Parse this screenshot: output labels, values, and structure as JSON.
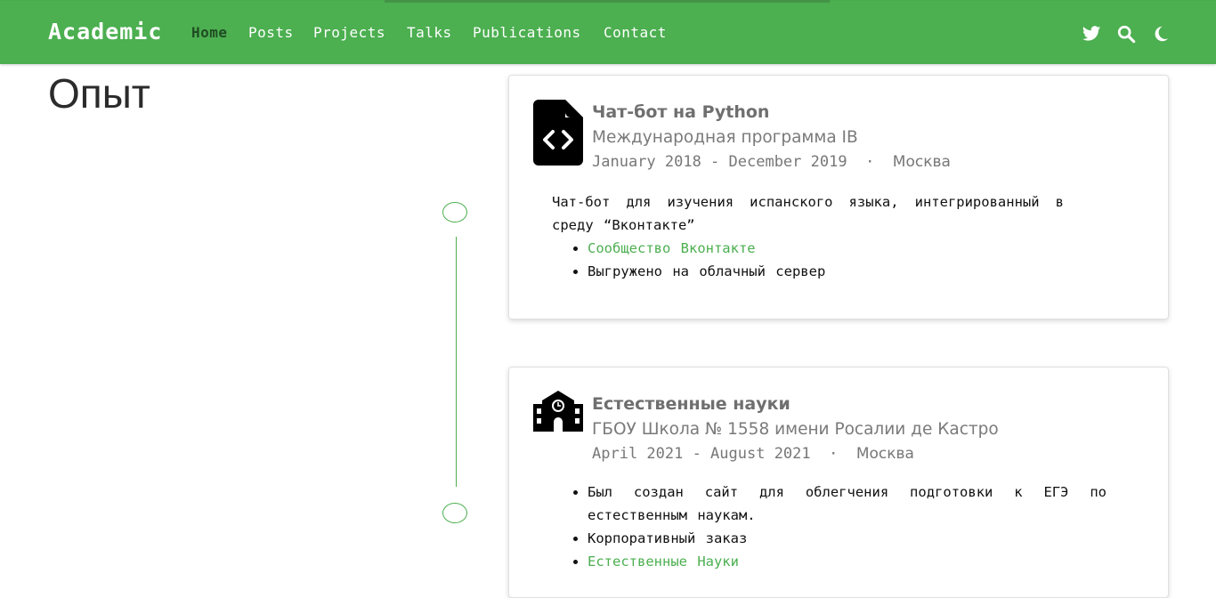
{
  "colors": {
    "accent": "#4caf50",
    "active_nav": "#1f4c22"
  },
  "navbar": {
    "brand": "Academic",
    "items": [
      {
        "label": "Home",
        "active": true
      },
      {
        "label": "Posts"
      },
      {
        "label": "Projects"
      },
      {
        "label": "Talks"
      },
      {
        "label": "Publications"
      },
      {
        "label": "Contact"
      }
    ],
    "icons": [
      "twitter-icon",
      "search-icon",
      "moon-icon"
    ]
  },
  "page": {
    "title": "Опыт"
  },
  "experience": [
    {
      "icon": "file-code-icon",
      "title": "Чат-бот на Python",
      "organization": "Международная программа IB",
      "dates": "January 2018 - December 2019",
      "separator": "·",
      "location": "Москва",
      "description": "Чат-бот для изучения испанского языка, интегрированный в среду “Вконтакте”",
      "bullets": [
        {
          "text": "Сообщество Вконтакте",
          "link": true
        },
        {
          "text": "Выгружено на облачный сервер",
          "link": false
        }
      ]
    },
    {
      "icon": "school-icon",
      "title": "Естественные науки",
      "organization": "ГБОУ Школа № 1558 имени Росалии де Кастро",
      "dates": "April 2021 - August 2021",
      "separator": "·",
      "location": "Москва",
      "bullets": [
        {
          "text": "Был создан сайт для облегчения подготовки к ЕГЭ по естественным наукам.",
          "link": false
        },
        {
          "text": "Корпоративный заказ",
          "link": false
        },
        {
          "text": "Естественные Науки",
          "link": true
        }
      ]
    }
  ]
}
